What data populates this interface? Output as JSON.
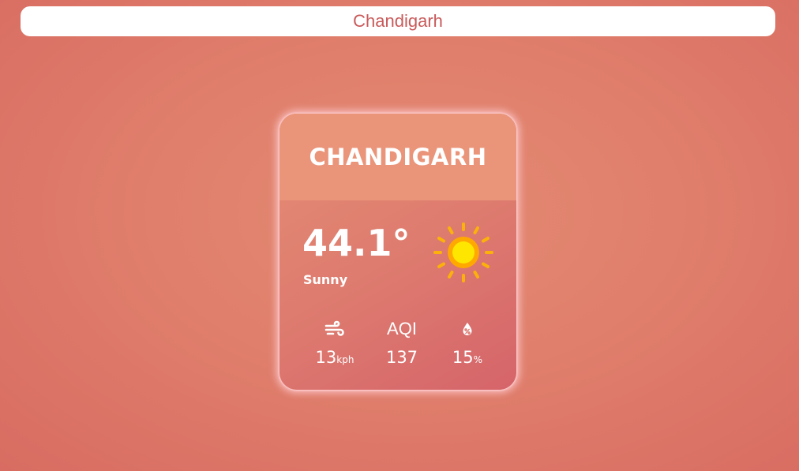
{
  "search": {
    "value": "Chandigarh"
  },
  "card": {
    "city": "CHANDIGARH",
    "temperature": "44.1°",
    "condition": "Sunny",
    "condition_icon": "sun-icon",
    "stats": {
      "wind": {
        "icon": "wind-icon",
        "value": "13",
        "unit": "kph"
      },
      "aqi": {
        "label": "AQI",
        "value": "137"
      },
      "humidity": {
        "icon": "humidity-drop-icon",
        "value": "15",
        "unit": "%"
      }
    }
  },
  "colors": {
    "background": "#e07f6c",
    "card_header": "#ea957a",
    "search_text": "#c95a5a",
    "sun_core": "#ffe600",
    "sun_rays": "#ffb400"
  }
}
